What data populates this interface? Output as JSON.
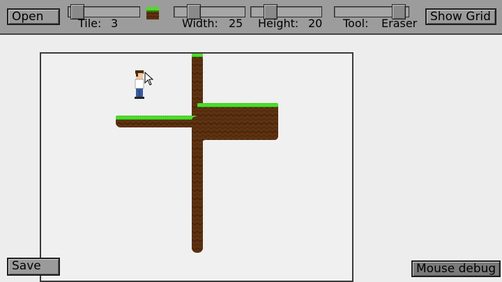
{
  "toolbar": {
    "open_label": "Open",
    "show_grid_label": "Show Grid",
    "tile": {
      "label": "Tile:",
      "value": "3",
      "slider_fraction": 0.04
    },
    "width": {
      "label": "Width:",
      "value": "25",
      "slider_fraction": 0.22
    },
    "height": {
      "label": "Height:",
      "value": "20",
      "slider_fraction": 0.22
    },
    "tool": {
      "label": "Tool:",
      "value": "Eraser",
      "slider_fraction": 0.95
    },
    "selected_tile_icon": "grass-dirt-tile-icon"
  },
  "footer": {
    "save_label": "Save",
    "mouse_debug_label": "Mouse debug"
  },
  "colors": {
    "toolbar_bg": "#9c9c9c",
    "canvas_bg": "#f0f0f0",
    "grass": "#4cdd2a",
    "dirt": "#5e3211",
    "dirt_dark": "#3f1f08"
  }
}
